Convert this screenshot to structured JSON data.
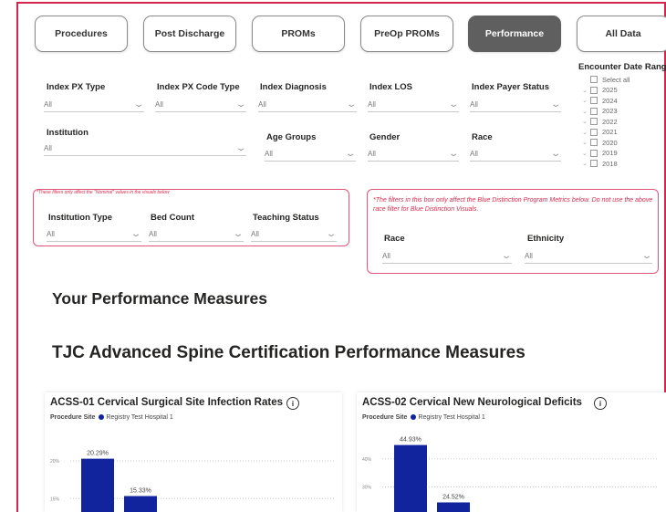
{
  "nav": {
    "buttons": [
      {
        "label": "Procedures",
        "active": false
      },
      {
        "label": "Post Discharge",
        "active": false
      },
      {
        "label": "PROMs",
        "active": false
      },
      {
        "label": "PreOp PROMs",
        "active": false
      },
      {
        "label": "Performance",
        "active": true
      },
      {
        "label": "All Data",
        "active": false
      }
    ]
  },
  "filters": {
    "index_px_type": {
      "label": "Index PX Type",
      "value": "All"
    },
    "index_px_code_type": {
      "label": "Index PX Code Type",
      "value": "All"
    },
    "index_diagnosis": {
      "label": "Index Diagnosis",
      "value": "All"
    },
    "index_los": {
      "label": "Index LOS",
      "value": "All"
    },
    "index_payer_status": {
      "label": "Index Payer Status",
      "value": "All"
    },
    "institution": {
      "label": "Institution",
      "value": "All"
    },
    "age_groups": {
      "label": "Age Groups",
      "value": "All"
    },
    "gender": {
      "label": "Gender",
      "value": "All"
    },
    "race": {
      "label": "Race",
      "value": "All"
    }
  },
  "date_range": {
    "title": "Encounter Date Range",
    "items": [
      "Select all",
      "2025",
      "2024",
      "2023",
      "2022",
      "2021",
      "2020",
      "2019",
      "2018"
    ]
  },
  "nominal_box": {
    "note": "*These filters only affect the \"Nominal\" values in the visuals below",
    "institution_type": {
      "label": "Institution Type",
      "value": "All"
    },
    "bed_count": {
      "label": "Bed Count",
      "value": "All"
    },
    "teaching_status": {
      "label": "Teaching Status",
      "value": "All"
    }
  },
  "blue_box": {
    "note": "*The filters in this box only affect the Blue Distinction Program Metrics below. Do not use the above race filter for Blue Distinction Visuals.",
    "race": {
      "label": "Race",
      "value": "All"
    },
    "ethnicity": {
      "label": "Ethnicity",
      "value": "All"
    }
  },
  "headings": {
    "your_performance": "Your Performance Measures",
    "tjc": "TJC Advanced Spine Certification Performance Measures"
  },
  "charts": {
    "acss01": {
      "title": "ACSS-01 Cervical Surgical Site Infection Rates",
      "legend_title": "Procedure Site",
      "legend_series": "Registry Test Hospital 1",
      "info": "i"
    },
    "acss02": {
      "title": "ACSS-02 Cervical New Neurological Deficits",
      "legend_title": "Procedure Site",
      "legend_series": "Registry Test Hospital 1",
      "info": "i"
    }
  },
  "chart_data": [
    {
      "type": "bar",
      "title": "ACSS-01 Cervical Surgical Site Infection Rates",
      "legend": [
        "Registry Test Hospital 1"
      ],
      "series": [
        {
          "name": "Registry Test Hospital 1",
          "values": [
            20.29,
            15.33
          ]
        }
      ],
      "data_labels": [
        "20.29%",
        "15.33%"
      ],
      "y_ticks": [
        "20%",
        "15%"
      ],
      "ylim": [
        0,
        24
      ],
      "color": "#12239e",
      "grid": true
    },
    {
      "type": "bar",
      "title": "ACSS-02 Cervical New Neurological Deficits",
      "legend": [
        "Registry Test Hospital 1"
      ],
      "series": [
        {
          "name": "Registry Test Hospital 1",
          "values": [
            44.93,
            24.52
          ]
        }
      ],
      "data_labels": [
        "44.93%",
        "24.52%"
      ],
      "y_ticks": [
        "40%",
        "30%"
      ],
      "ylim": [
        0,
        50
      ],
      "color": "#12239e",
      "grid": true
    }
  ]
}
